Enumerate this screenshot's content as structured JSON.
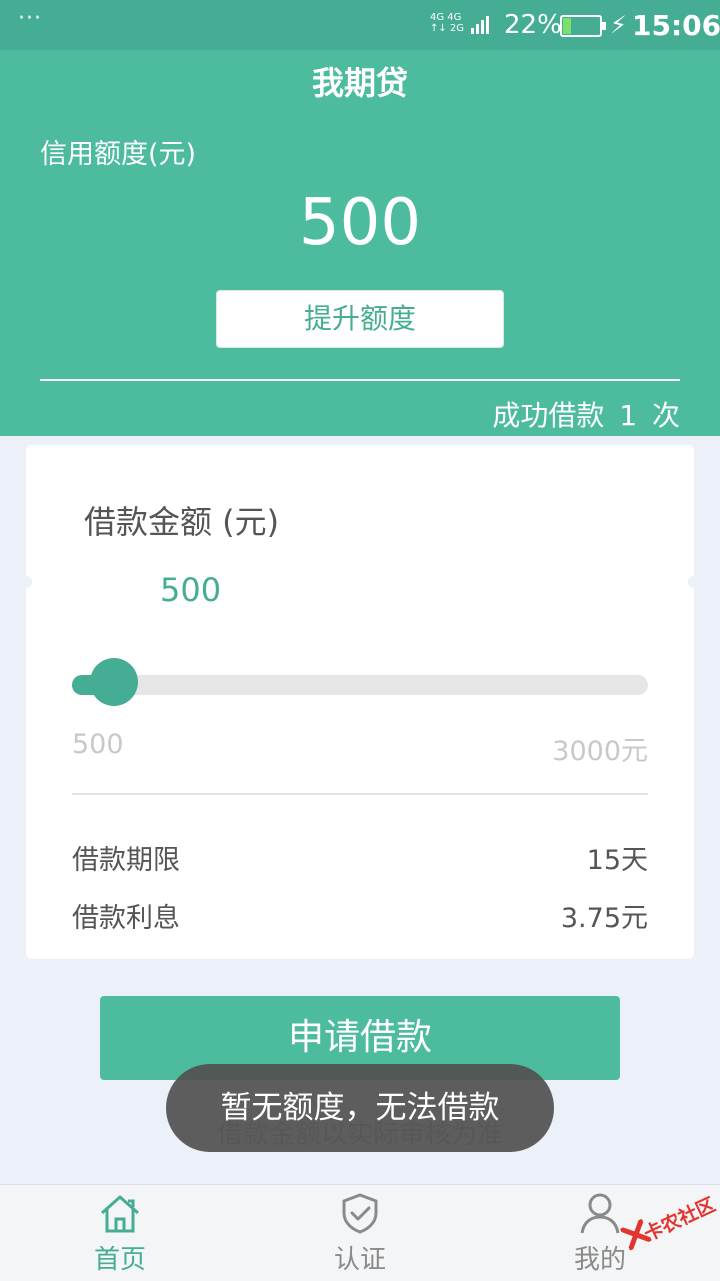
{
  "status_bar": {
    "menu_dots": "···",
    "network_top": "4G 4G",
    "network_bottom": "↑↓ 2G",
    "battery_percent": "22%",
    "battery_level": 0.22,
    "time": "15:06"
  },
  "header": {
    "title": "我期贷",
    "credit_label": "信用额度(元)",
    "credit_value": "500",
    "raise_button": "提升额度",
    "success_text": "成功借款 1 次"
  },
  "loan": {
    "amount_label": "借款金额 (元)",
    "amount_value": "500",
    "slider_min": "500",
    "slider_max": "3000元",
    "slider_fraction": 0,
    "term_label": "借款期限",
    "term_value": "15天",
    "interest_label": "借款利息",
    "interest_value": "3.75元"
  },
  "actions": {
    "apply_button": "申请借款",
    "note": "借款金额以实际审核为准"
  },
  "toast": "暂无额度，无法借款",
  "tabs": [
    {
      "label": "首页",
      "icon": "home-icon",
      "active": true
    },
    {
      "label": "认证",
      "icon": "shield-check-icon",
      "active": false
    },
    {
      "label": "我的",
      "icon": "user-icon",
      "active": false
    }
  ],
  "watermark": "卡农社区",
  "colors": {
    "accent": "#4cbb9e",
    "accent_dark": "#45ad93",
    "tab_active": "#45ad93",
    "tab_inactive": "#8a8a8a",
    "background": "#ecf0f8"
  }
}
